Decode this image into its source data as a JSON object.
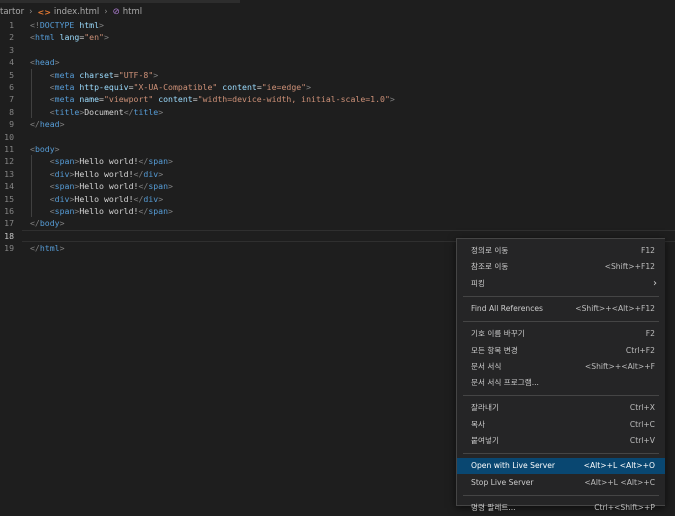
{
  "breadcrumb": {
    "folder": "tartor",
    "file": "index.html",
    "element": "html"
  },
  "code_lines": [
    {
      "n": "1",
      "parts": [
        [
          "punc",
          "<!"
        ],
        [
          "tag",
          "DOCTYPE"
        ],
        [
          "text",
          " "
        ],
        [
          "attr",
          "html"
        ],
        [
          "punc",
          ">"
        ]
      ]
    },
    {
      "n": "2",
      "parts": [
        [
          "punc",
          "<"
        ],
        [
          "tag",
          "html"
        ],
        [
          "text",
          " "
        ],
        [
          "attr",
          "lang"
        ],
        [
          "text",
          "="
        ],
        [
          "val",
          "\"en\""
        ],
        [
          "punc",
          ">"
        ]
      ]
    },
    {
      "n": "3",
      "parts": []
    },
    {
      "n": "4",
      "parts": [
        [
          "punc",
          "<"
        ],
        [
          "tag",
          "head"
        ],
        [
          "punc",
          ">"
        ]
      ]
    },
    {
      "n": "5",
      "parts": [
        [
          "text",
          "    "
        ],
        [
          "punc",
          "<"
        ],
        [
          "tag",
          "meta"
        ],
        [
          "text",
          " "
        ],
        [
          "attr",
          "charset"
        ],
        [
          "text",
          "="
        ],
        [
          "val",
          "\"UTF-8\""
        ],
        [
          "punc",
          ">"
        ]
      ]
    },
    {
      "n": "6",
      "parts": [
        [
          "text",
          "    "
        ],
        [
          "punc",
          "<"
        ],
        [
          "tag",
          "meta"
        ],
        [
          "text",
          " "
        ],
        [
          "attr",
          "http-equiv"
        ],
        [
          "text",
          "="
        ],
        [
          "val",
          "\"X-UA-Compatible\""
        ],
        [
          "text",
          " "
        ],
        [
          "attr",
          "content"
        ],
        [
          "text",
          "="
        ],
        [
          "val",
          "\"ie=edge\""
        ],
        [
          "punc",
          ">"
        ]
      ]
    },
    {
      "n": "7",
      "parts": [
        [
          "text",
          "    "
        ],
        [
          "punc",
          "<"
        ],
        [
          "tag",
          "meta"
        ],
        [
          "text",
          " "
        ],
        [
          "attr",
          "name"
        ],
        [
          "text",
          "="
        ],
        [
          "val",
          "\"viewport\""
        ],
        [
          "text",
          " "
        ],
        [
          "attr",
          "content"
        ],
        [
          "text",
          "="
        ],
        [
          "val",
          "\"width=device-width, initial-scale=1.0\""
        ],
        [
          "punc",
          ">"
        ]
      ]
    },
    {
      "n": "8",
      "parts": [
        [
          "text",
          "    "
        ],
        [
          "punc",
          "<"
        ],
        [
          "tag",
          "title"
        ],
        [
          "punc",
          ">"
        ],
        [
          "text",
          "Document"
        ],
        [
          "punc",
          "</"
        ],
        [
          "tag",
          "title"
        ],
        [
          "punc",
          ">"
        ]
      ]
    },
    {
      "n": "9",
      "parts": [
        [
          "punc",
          "</"
        ],
        [
          "tag",
          "head"
        ],
        [
          "punc",
          ">"
        ]
      ]
    },
    {
      "n": "10",
      "parts": []
    },
    {
      "n": "11",
      "parts": [
        [
          "punc",
          "<"
        ],
        [
          "tag",
          "body"
        ],
        [
          "punc",
          ">"
        ]
      ]
    },
    {
      "n": "12",
      "parts": [
        [
          "text",
          "    "
        ],
        [
          "punc",
          "<"
        ],
        [
          "tag",
          "span"
        ],
        [
          "punc",
          ">"
        ],
        [
          "text",
          "Hello world!"
        ],
        [
          "punc",
          "</"
        ],
        [
          "tag",
          "span"
        ],
        [
          "punc",
          ">"
        ]
      ]
    },
    {
      "n": "13",
      "parts": [
        [
          "text",
          "    "
        ],
        [
          "punc",
          "<"
        ],
        [
          "tag",
          "div"
        ],
        [
          "punc",
          ">"
        ],
        [
          "text",
          "Hello world!"
        ],
        [
          "punc",
          "</"
        ],
        [
          "tag",
          "div"
        ],
        [
          "punc",
          ">"
        ]
      ]
    },
    {
      "n": "14",
      "parts": [
        [
          "text",
          "    "
        ],
        [
          "punc",
          "<"
        ],
        [
          "tag",
          "span"
        ],
        [
          "punc",
          ">"
        ],
        [
          "text",
          "Hello world!"
        ],
        [
          "punc",
          "</"
        ],
        [
          "tag",
          "span"
        ],
        [
          "punc",
          ">"
        ]
      ]
    },
    {
      "n": "15",
      "parts": [
        [
          "text",
          "    "
        ],
        [
          "punc",
          "<"
        ],
        [
          "tag",
          "div"
        ],
        [
          "punc",
          ">"
        ],
        [
          "text",
          "Hello world!"
        ],
        [
          "punc",
          "</"
        ],
        [
          "tag",
          "div"
        ],
        [
          "punc",
          ">"
        ]
      ]
    },
    {
      "n": "16",
      "parts": [
        [
          "text",
          "    "
        ],
        [
          "punc",
          "<"
        ],
        [
          "tag",
          "span"
        ],
        [
          "punc",
          ">"
        ],
        [
          "text",
          "Hello world!"
        ],
        [
          "punc",
          "</"
        ],
        [
          "tag",
          "span"
        ],
        [
          "punc",
          ">"
        ]
      ]
    },
    {
      "n": "17",
      "parts": [
        [
          "punc",
          "</"
        ],
        [
          "tag",
          "body"
        ],
        [
          "punc",
          ">"
        ]
      ]
    },
    {
      "n": "18",
      "parts": []
    },
    {
      "n": "19",
      "parts": [
        [
          "punc",
          "</"
        ],
        [
          "tag",
          "html"
        ],
        [
          "punc",
          ">"
        ]
      ]
    }
  ],
  "cursor_line": "18",
  "context_menu": {
    "items": [
      {
        "label": "정의로 이동",
        "key": "F12"
      },
      {
        "label": "참조로 이동",
        "key": "<Shift>+F12"
      },
      {
        "label": "피킹",
        "key": "",
        "submenu": true
      },
      {
        "sep": true
      },
      {
        "label": "Find All References",
        "key": "<Shift>+<Alt>+F12"
      },
      {
        "sep": true
      },
      {
        "label": "기호 이름 바꾸기",
        "key": "F2"
      },
      {
        "label": "모든 항목 변경",
        "key": "Ctrl+F2"
      },
      {
        "label": "문서 서식",
        "key": "<Shift>+<Alt>+F"
      },
      {
        "label": "문서 서식 프로그램...",
        "key": ""
      },
      {
        "sep": true
      },
      {
        "label": "잘라내기",
        "key": "Ctrl+X"
      },
      {
        "label": "복사",
        "key": "Ctrl+C"
      },
      {
        "label": "붙여넣기",
        "key": "Ctrl+V"
      },
      {
        "sep": true
      },
      {
        "label": "Open with Live Server",
        "key": "<Alt>+L <Alt>+O",
        "active": true
      },
      {
        "label": "Stop Live Server",
        "key": "<Alt>+L <Alt>+C"
      },
      {
        "sep": true
      },
      {
        "label": "명령 팔레트...",
        "key": "Ctrl+<Shift>+P"
      }
    ]
  },
  "colors": {
    "background": "#1e1e1e",
    "menu_background": "#252526",
    "menu_highlight": "#094771",
    "tag": "#569cd6",
    "attribute": "#9cdcfe",
    "string": "#ce9178"
  }
}
